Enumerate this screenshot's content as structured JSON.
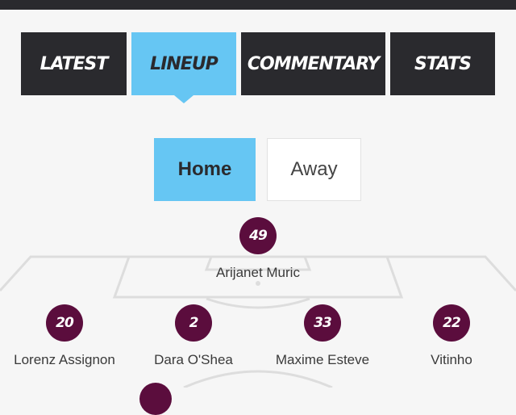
{
  "tabs": [
    {
      "label": "LATEST",
      "active": false
    },
    {
      "label": "LINEUP",
      "active": true
    },
    {
      "label": "COMMENTARY",
      "active": false
    },
    {
      "label": "STATS",
      "active": false
    }
  ],
  "team_toggle": {
    "home_label": "Home",
    "away_label": "Away",
    "selected": "Home"
  },
  "players": [
    {
      "number": "49",
      "name": "Arijanet Muric"
    },
    {
      "number": "20",
      "name": "Lorenz Assignon"
    },
    {
      "number": "2",
      "name": "Dara O'Shea"
    },
    {
      "number": "33",
      "name": "Maxime Esteve"
    },
    {
      "number": "22",
      "name": "Vitinho"
    }
  ],
  "colors": {
    "tab_bg": "#2a2a2e",
    "accent": "#66c6f3",
    "badge": "#5b0d3d",
    "pitch_lines": "#dddddd"
  }
}
